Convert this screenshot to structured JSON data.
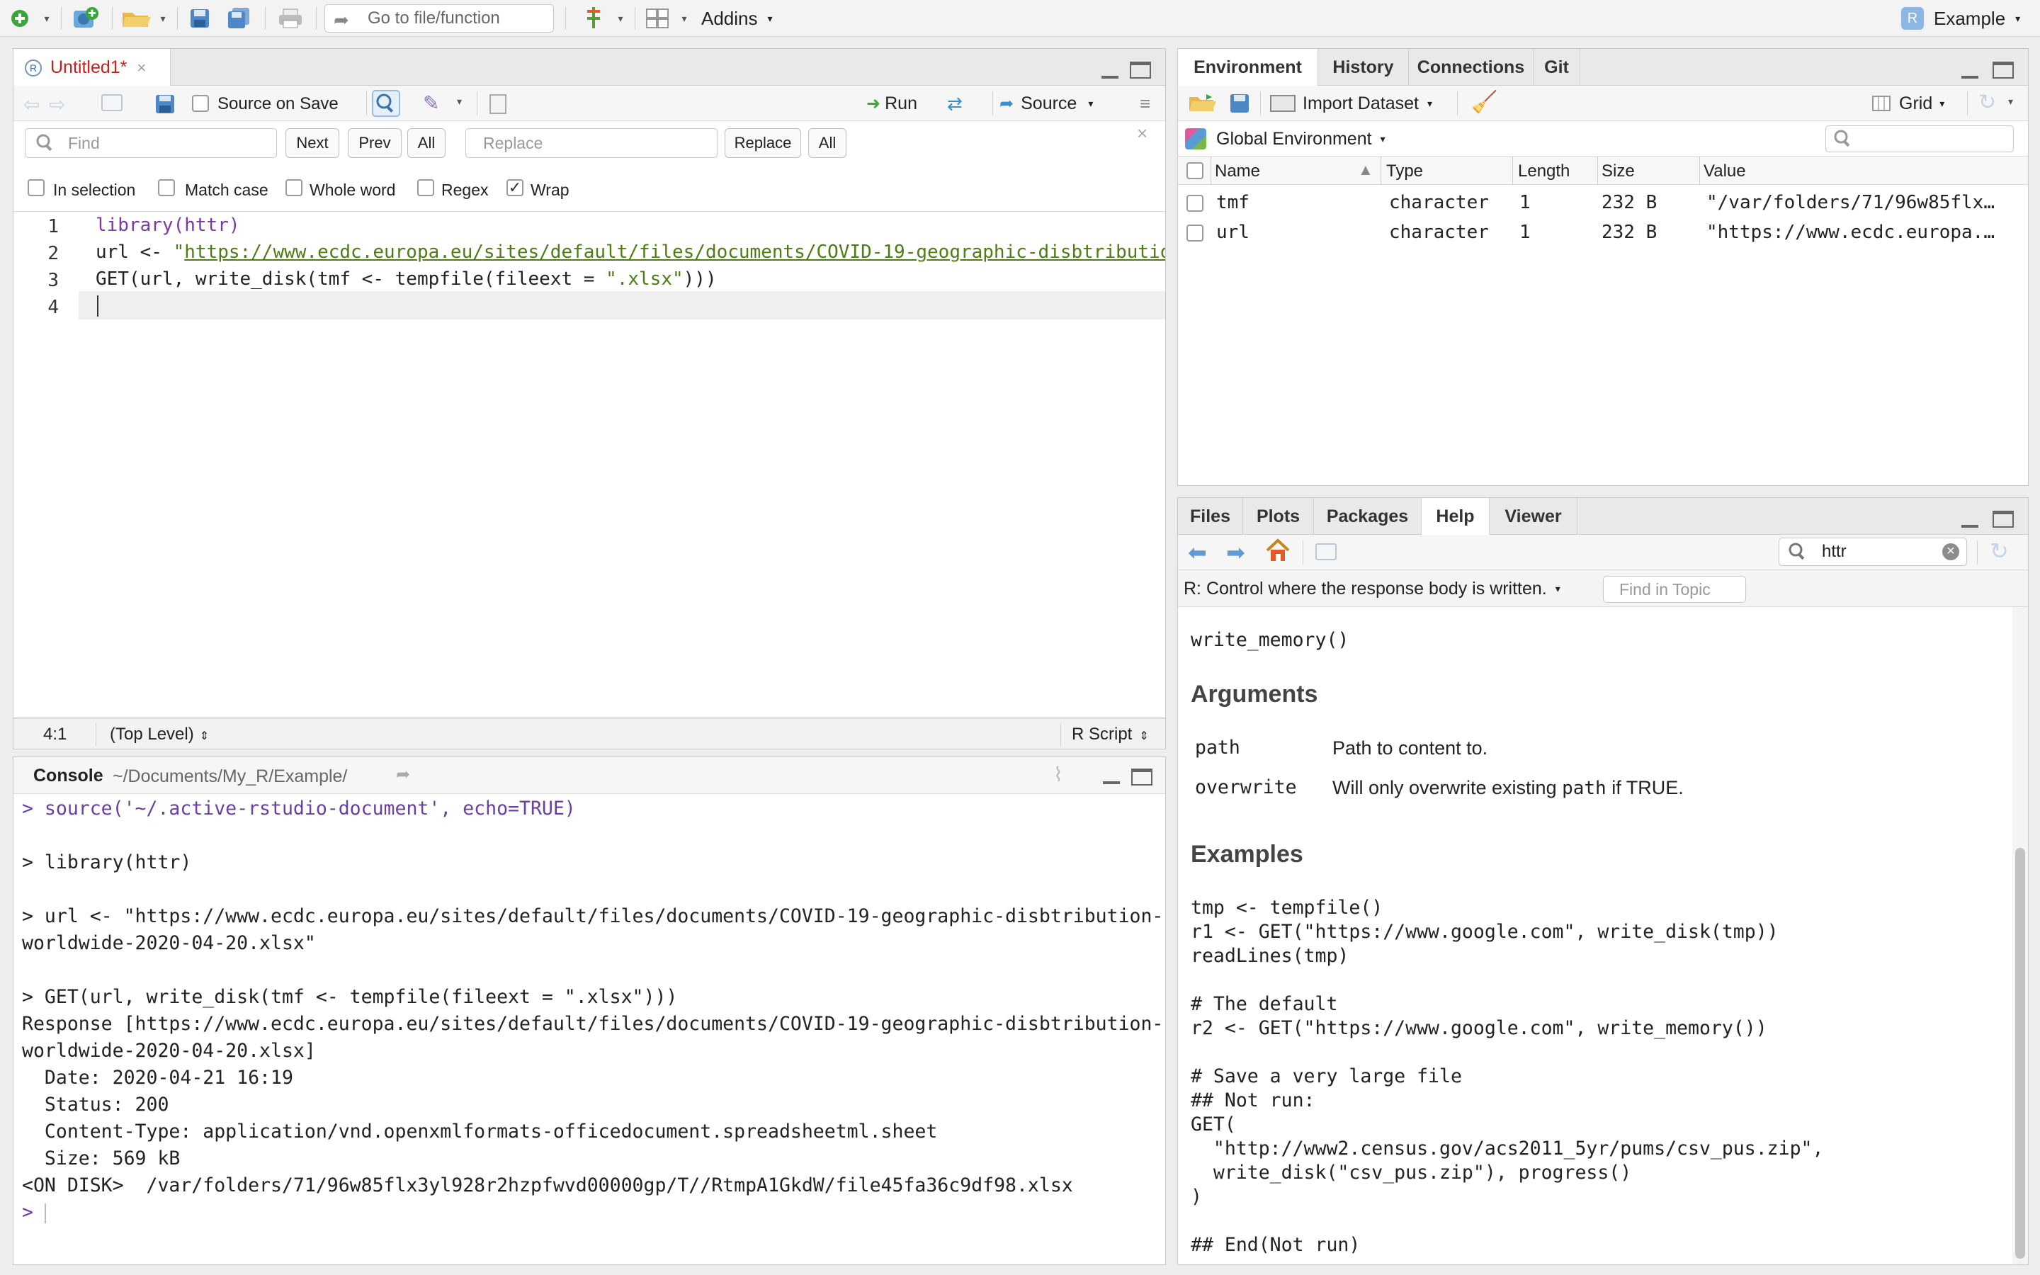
{
  "toolbar": {
    "goto_placeholder": "Go to file/function",
    "addins": "Addins",
    "project": "Example"
  },
  "editor": {
    "tab_title": "Untitled1*",
    "source_on_save": "Source on Save",
    "run": "Run",
    "source": "Source",
    "find": {
      "find_placeholder": "Find",
      "next": "Next",
      "prev": "Prev",
      "all": "All",
      "replace_placeholder": "Replace",
      "replace": "Replace",
      "replace_all": "All",
      "in_selection": "In selection",
      "match_case": "Match case",
      "whole_word": "Whole word",
      "regex": "Regex",
      "wrap": "Wrap"
    },
    "line_numbers": [
      "1",
      "2",
      "3",
      "4"
    ],
    "lines": [
      {
        "kw": "library",
        "rest": "(httr)"
      },
      {
        "pre": "url <- ",
        "q": "\"",
        "url": "https://www.ecdc.europa.eu/sites/default/files/documents/COVID-19-geographic-disbtributio"
      },
      {
        "pre": "GET(url, write_disk(tmf <- tempfile(fileext = ",
        "str": "\".xlsx\"",
        "post": ")))"
      }
    ],
    "status_pos": "4:1",
    "status_scope": "(Top Level)",
    "status_type": "R Script"
  },
  "console": {
    "title": "Console",
    "path": "~/Documents/My_R/Example/",
    "lines": [
      "> source('~/.active-rstudio-document', echo=TRUE)",
      "",
      "> library(httr)",
      "",
      "> url <- \"https://www.ecdc.europa.eu/sites/default/files/documents/COVID-19-geographic-disbtribution-",
      "worldwide-2020-04-20.xlsx\"",
      "",
      "> GET(url, write_disk(tmf <- tempfile(fileext = \".xlsx\")))",
      "Response [https://www.ecdc.europa.eu/sites/default/files/documents/COVID-19-geographic-disbtribution-",
      "worldwide-2020-04-20.xlsx]",
      "  Date: 2020-04-21 16:19",
      "  Status: 200",
      "  Content-Type: application/vnd.openxmlformats-officedocument.spreadsheetml.sheet",
      "  Size: 569 kB",
      "<ON DISK>  /var/folders/71/96w85flx3yl928r2hzpfwvd00000gp/T//RtmpA1GkdW/file45fa36c9df98.xlsx",
      ">"
    ]
  },
  "env": {
    "tabs": [
      "Environment",
      "History",
      "Connections",
      "Git"
    ],
    "import_dataset": "Import Dataset",
    "grid": "Grid",
    "scope": "Global Environment",
    "columns": [
      "Name",
      "Type",
      "Length",
      "Size",
      "Value"
    ],
    "rows": [
      {
        "name": "tmf",
        "type": "character",
        "length": "1",
        "size": "232 B",
        "value": "\"/var/folders/71/96w85flx…"
      },
      {
        "name": "url",
        "type": "character",
        "length": "1",
        "size": "232 B",
        "value": "\"https://www.ecdc.europa.…"
      }
    ]
  },
  "help": {
    "tabs": [
      "Files",
      "Plots",
      "Packages",
      "Help",
      "Viewer"
    ],
    "search_value": "httr",
    "topic": "R: Control where the response body is written.",
    "find_in_topic": "Find in Topic",
    "write_memory": "write_memory()",
    "arguments_heading": "Arguments",
    "args": [
      {
        "name": "path",
        "desc": "Path to content to."
      },
      {
        "name": "overwrite",
        "desc_pre": "Will only overwrite existing ",
        "desc_code": "path",
        "desc_post": " if TRUE."
      }
    ],
    "examples_heading": "Examples",
    "examples": [
      "tmp <- tempfile()",
      "r1 <- GET(\"https://www.google.com\", write_disk(tmp))",
      "readLines(tmp)",
      "",
      "# The default",
      "r2 <- GET(\"https://www.google.com\", write_memory())",
      "",
      "# Save a very large file",
      "## Not run:",
      "GET(",
      "  \"http://www2.census.gov/acs2011_5yr/pums/csv_pus.zip\",",
      "  write_disk(\"csv_pus.zip\"), progress()",
      ")",
      "",
      "## End(Not run)"
    ]
  }
}
